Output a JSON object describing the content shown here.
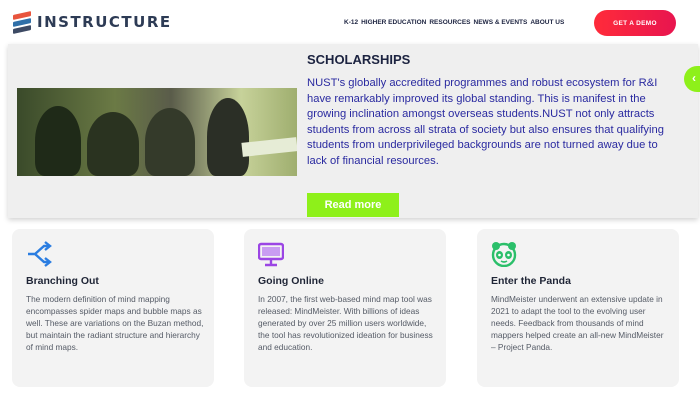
{
  "header": {
    "logo_text": "INSTRUCTURE",
    "nav": [
      "K-12",
      "HIGHER EDUCATION",
      "RESOURCES",
      "NEWS & EVENTS",
      "ABOUT US"
    ],
    "cta_label": "GET A DEMO"
  },
  "hero": {
    "title": "SCHOLARSHIPS",
    "body": "NUST's globally accredited programmes and robust ecosystem for R&I have remarkably improved its global standing. This is manifest in the growing inclination amongst overseas students.NUST not only attracts students from across all strata of society but also ensures that qualifying students from underprivileged backgrounds are not turned away due to lack of financial resources.",
    "button_label": "Read more",
    "side_tab_icon": "arrow-left-icon"
  },
  "cards": [
    {
      "icon": "branching-arrows-icon",
      "title": "Branching Out",
      "body": "The modern definition of mind mapping encompasses spider maps and bubble maps as well. These are variations on the Buzan method, but maintain the radiant structure and hierarchy of mind maps."
    },
    {
      "icon": "monitor-icon",
      "title": "Going Online",
      "body": "In 2007, the first web-based mind map tool was released: MindMeister. With billions of ideas generated by over 25 million users worldwide, the tool has revolutionized ideation for business and education."
    },
    {
      "icon": "panda-icon",
      "title": "Enter the Panda",
      "body": "MindMeister underwent an extensive update in 2021 to adapt the tool to the evolving user needs. Feedback from thousands of mind mappers helped create an all-new MindMeister – Project Panda."
    }
  ],
  "colors": {
    "brand": "#2d3b55",
    "cta": "#ff2b3a",
    "accent_green": "#8ef01a",
    "hero_text": "#2a2aa0",
    "icon_blue": "#2a7de1",
    "icon_purple": "#9b45e4",
    "icon_green": "#2bbf6a"
  }
}
